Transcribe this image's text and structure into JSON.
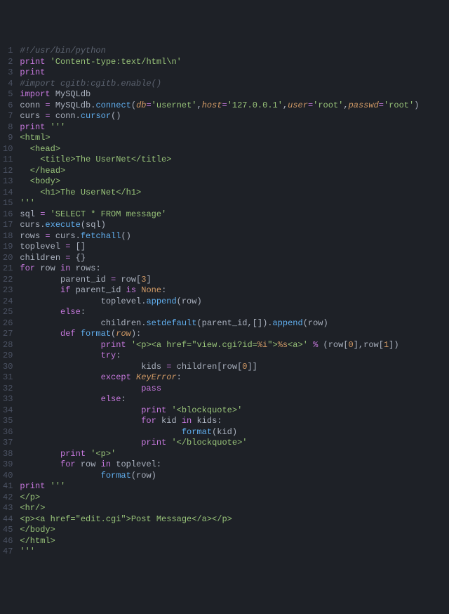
{
  "lines": [
    {
      "n": 1,
      "tokens": [
        [
          "c-comment",
          "#!/usr/bin/python"
        ]
      ]
    },
    {
      "n": 2,
      "tokens": [
        [
          "c-keyword",
          "print"
        ],
        [
          "c-plain",
          " "
        ],
        [
          "c-string",
          "'Content-type:text/html\\n'"
        ]
      ]
    },
    {
      "n": 3,
      "tokens": [
        [
          "c-keyword",
          "print"
        ]
      ]
    },
    {
      "n": 4,
      "tokens": [
        [
          "c-comment",
          "#import cgitb:cgitb.enable()"
        ]
      ]
    },
    {
      "n": 5,
      "tokens": [
        [
          "c-keyword",
          "import"
        ],
        [
          "c-plain",
          " MySQLdb"
        ]
      ]
    },
    {
      "n": 6,
      "tokens": [
        [
          "c-plain",
          "conn "
        ],
        [
          "c-keyword",
          "="
        ],
        [
          "c-plain",
          " MySQLdb."
        ],
        [
          "c-func",
          "connect"
        ],
        [
          "c-plain",
          "("
        ],
        [
          "c-param",
          "db"
        ],
        [
          "c-keyword",
          "="
        ],
        [
          "c-string",
          "'usernet'"
        ],
        [
          "c-plain",
          ","
        ],
        [
          "c-param",
          "host"
        ],
        [
          "c-keyword",
          "="
        ],
        [
          "c-string",
          "'127.0.0.1'"
        ],
        [
          "c-plain",
          ","
        ],
        [
          "c-param",
          "user"
        ],
        [
          "c-keyword",
          "="
        ],
        [
          "c-string",
          "'root'"
        ],
        [
          "c-plain",
          ","
        ],
        [
          "c-param",
          "passwd"
        ],
        [
          "c-keyword",
          "="
        ],
        [
          "c-string",
          "'root'"
        ],
        [
          "c-plain",
          ")"
        ]
      ]
    },
    {
      "n": 7,
      "tokens": [
        [
          "c-plain",
          "curs "
        ],
        [
          "c-keyword",
          "="
        ],
        [
          "c-plain",
          " conn."
        ],
        [
          "c-func",
          "cursor"
        ],
        [
          "c-plain",
          "()"
        ]
      ]
    },
    {
      "n": 8,
      "tokens": [
        [
          "c-keyword",
          "print"
        ],
        [
          "c-plain",
          " "
        ],
        [
          "c-string",
          "'''"
        ]
      ]
    },
    {
      "n": 9,
      "tokens": [
        [
          "c-string",
          "<html>"
        ]
      ]
    },
    {
      "n": 10,
      "tokens": [
        [
          "c-string",
          "  <head>"
        ]
      ]
    },
    {
      "n": 11,
      "tokens": [
        [
          "c-string",
          "    <title>The UserNet</title>"
        ]
      ]
    },
    {
      "n": 12,
      "tokens": [
        [
          "c-string",
          "  </head>"
        ]
      ]
    },
    {
      "n": 13,
      "tokens": [
        [
          "c-string",
          "  <body>"
        ]
      ]
    },
    {
      "n": 14,
      "tokens": [
        [
          "c-string",
          "    <h1>The UserNet</h1>"
        ]
      ]
    },
    {
      "n": 15,
      "tokens": [
        [
          "c-string",
          "'''"
        ]
      ]
    },
    {
      "n": 16,
      "tokens": [
        [
          "c-plain",
          "sql "
        ],
        [
          "c-keyword",
          "="
        ],
        [
          "c-plain",
          " "
        ],
        [
          "c-string",
          "'SELECT * FROM message'"
        ]
      ]
    },
    {
      "n": 17,
      "tokens": [
        [
          "c-plain",
          "curs."
        ],
        [
          "c-func",
          "execute"
        ],
        [
          "c-plain",
          "(sql)"
        ]
      ]
    },
    {
      "n": 18,
      "tokens": [
        [
          "c-plain",
          "rows "
        ],
        [
          "c-keyword",
          "="
        ],
        [
          "c-plain",
          " curs."
        ],
        [
          "c-func",
          "fetchall"
        ],
        [
          "c-plain",
          "()"
        ]
      ]
    },
    {
      "n": 19,
      "tokens": [
        [
          "c-plain",
          "toplevel "
        ],
        [
          "c-keyword",
          "="
        ],
        [
          "c-plain",
          " []"
        ]
      ]
    },
    {
      "n": 20,
      "tokens": [
        [
          "c-plain",
          "children "
        ],
        [
          "c-keyword",
          "="
        ],
        [
          "c-plain",
          " {}"
        ]
      ]
    },
    {
      "n": 21,
      "tokens": [
        [
          "c-keyword",
          "for"
        ],
        [
          "c-plain",
          " row "
        ],
        [
          "c-keyword",
          "in"
        ],
        [
          "c-plain",
          " rows:"
        ]
      ]
    },
    {
      "n": 22,
      "tokens": [
        [
          "c-plain",
          "        parent_id "
        ],
        [
          "c-keyword",
          "="
        ],
        [
          "c-plain",
          " row["
        ],
        [
          "c-number",
          "3"
        ],
        [
          "c-plain",
          "]"
        ]
      ]
    },
    {
      "n": 23,
      "tokens": [
        [
          "c-plain",
          "        "
        ],
        [
          "c-keyword",
          "if"
        ],
        [
          "c-plain",
          " parent_id "
        ],
        [
          "c-keyword",
          "is"
        ],
        [
          "c-plain",
          " "
        ],
        [
          "c-const",
          "None"
        ],
        [
          "c-plain",
          ":"
        ]
      ]
    },
    {
      "n": 24,
      "tokens": [
        [
          "c-plain",
          "                toplevel."
        ],
        [
          "c-func",
          "append"
        ],
        [
          "c-plain",
          "(row)"
        ]
      ]
    },
    {
      "n": 25,
      "tokens": [
        [
          "c-plain",
          "        "
        ],
        [
          "c-keyword",
          "else"
        ],
        [
          "c-plain",
          ":"
        ]
      ]
    },
    {
      "n": 26,
      "tokens": [
        [
          "c-plain",
          "                children."
        ],
        [
          "c-func",
          "setdefault"
        ],
        [
          "c-plain",
          "(parent_id,[])."
        ],
        [
          "c-func",
          "append"
        ],
        [
          "c-plain",
          "(row)"
        ]
      ]
    },
    {
      "n": 27,
      "tokens": [
        [
          "c-plain",
          "        "
        ],
        [
          "c-keyword",
          "def"
        ],
        [
          "c-plain",
          " "
        ],
        [
          "c-func",
          "format"
        ],
        [
          "c-plain",
          "("
        ],
        [
          "c-param",
          "row"
        ],
        [
          "c-plain",
          "):"
        ]
      ]
    },
    {
      "n": 28,
      "tokens": [
        [
          "c-plain",
          "                "
        ],
        [
          "c-keyword",
          "print"
        ],
        [
          "c-plain",
          " "
        ],
        [
          "c-string",
          "'<p><a href=\"view.cgi?id="
        ],
        [
          "c-const",
          "%i"
        ],
        [
          "c-string",
          "\">"
        ],
        [
          "c-const",
          "%s"
        ],
        [
          "c-string",
          "<a>'"
        ],
        [
          "c-plain",
          " "
        ],
        [
          "c-keyword",
          "%"
        ],
        [
          "c-plain",
          " (row["
        ],
        [
          "c-number",
          "0"
        ],
        [
          "c-plain",
          "],row["
        ],
        [
          "c-number",
          "1"
        ],
        [
          "c-plain",
          "])"
        ]
      ]
    },
    {
      "n": 29,
      "tokens": [
        [
          "c-plain",
          "                "
        ],
        [
          "c-keyword",
          "try"
        ],
        [
          "c-plain",
          ":"
        ]
      ]
    },
    {
      "n": 30,
      "tokens": [
        [
          "c-plain",
          "                        kids "
        ],
        [
          "c-keyword",
          "="
        ],
        [
          "c-plain",
          " children[row["
        ],
        [
          "c-number",
          "0"
        ],
        [
          "c-plain",
          "]]"
        ]
      ]
    },
    {
      "n": 31,
      "tokens": [
        [
          "c-plain",
          "                "
        ],
        [
          "c-keyword",
          "except"
        ],
        [
          "c-plain",
          " "
        ],
        [
          "c-param",
          "KeyError"
        ],
        [
          "c-plain",
          ":"
        ]
      ]
    },
    {
      "n": 32,
      "tokens": [
        [
          "c-plain",
          "                        "
        ],
        [
          "c-keyword",
          "pass"
        ]
      ]
    },
    {
      "n": 33,
      "tokens": [
        [
          "c-plain",
          "                "
        ],
        [
          "c-keyword",
          "else"
        ],
        [
          "c-plain",
          ":"
        ]
      ]
    },
    {
      "n": 34,
      "tokens": [
        [
          "c-plain",
          "                        "
        ],
        [
          "c-keyword",
          "print"
        ],
        [
          "c-plain",
          " "
        ],
        [
          "c-string",
          "'<blockquote>'"
        ]
      ]
    },
    {
      "n": 35,
      "tokens": [
        [
          "c-plain",
          "                        "
        ],
        [
          "c-keyword",
          "for"
        ],
        [
          "c-plain",
          " kid "
        ],
        [
          "c-keyword",
          "in"
        ],
        [
          "c-plain",
          " kids:"
        ]
      ]
    },
    {
      "n": 36,
      "tokens": [
        [
          "c-plain",
          "                                "
        ],
        [
          "c-func",
          "format"
        ],
        [
          "c-plain",
          "(kid)"
        ]
      ]
    },
    {
      "n": 37,
      "tokens": [
        [
          "c-plain",
          "                        "
        ],
        [
          "c-keyword",
          "print"
        ],
        [
          "c-plain",
          " "
        ],
        [
          "c-string",
          "'</blockquote>'"
        ]
      ]
    },
    {
      "n": 38,
      "tokens": [
        [
          "c-plain",
          "        "
        ],
        [
          "c-keyword",
          "print"
        ],
        [
          "c-plain",
          " "
        ],
        [
          "c-string",
          "'<p>'"
        ]
      ]
    },
    {
      "n": 39,
      "tokens": [
        [
          "c-plain",
          "        "
        ],
        [
          "c-keyword",
          "for"
        ],
        [
          "c-plain",
          " row "
        ],
        [
          "c-keyword",
          "in"
        ],
        [
          "c-plain",
          " toplevel:"
        ]
      ]
    },
    {
      "n": 40,
      "tokens": [
        [
          "c-plain",
          "                "
        ],
        [
          "c-func",
          "format"
        ],
        [
          "c-plain",
          "(row)"
        ]
      ]
    },
    {
      "n": 41,
      "tokens": [
        [
          "c-keyword",
          "print"
        ],
        [
          "c-plain",
          " "
        ],
        [
          "c-string",
          "'''"
        ]
      ]
    },
    {
      "n": 42,
      "tokens": [
        [
          "c-string",
          "</p>"
        ]
      ]
    },
    {
      "n": 43,
      "tokens": [
        [
          "c-string",
          "<hr/>"
        ]
      ]
    },
    {
      "n": 44,
      "tokens": [
        [
          "c-string",
          "<p><a href=\"edit.cgi\">Post Message</a></p>"
        ]
      ]
    },
    {
      "n": 45,
      "tokens": [
        [
          "c-string",
          "</body>"
        ]
      ]
    },
    {
      "n": 46,
      "tokens": [
        [
          "c-string",
          "</html>"
        ]
      ]
    },
    {
      "n": 47,
      "tokens": [
        [
          "c-string",
          "'''"
        ]
      ]
    }
  ]
}
